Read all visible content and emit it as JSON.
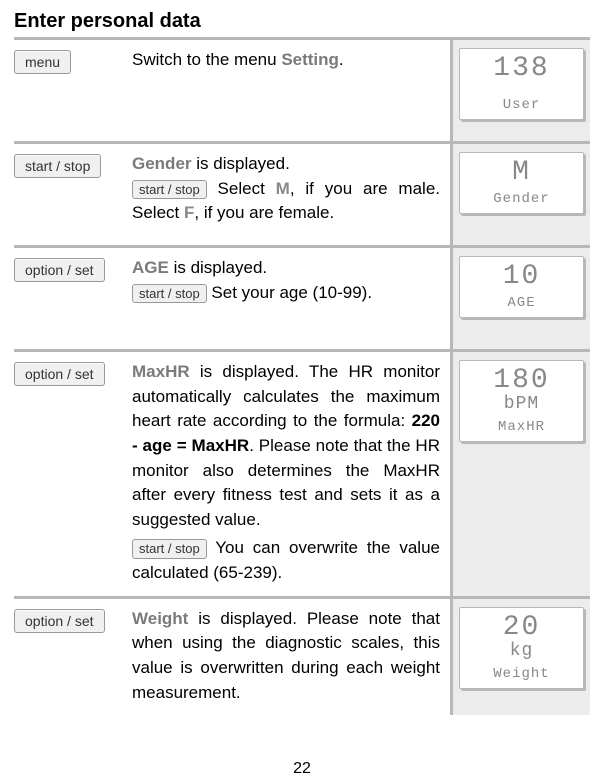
{
  "title": "Enter personal data",
  "page_number": "22",
  "buttons": {
    "menu": "menu",
    "start_stop": "start / stop",
    "option_set": "option / set"
  },
  "rows": [
    {
      "button": "menu",
      "text_before": "Switch to the menu ",
      "text_highlight": "Setting",
      "text_after": ".",
      "lcd_top": "138",
      "lcd_label": "User"
    },
    {
      "button": "start_stop",
      "lead_highlight": "Gender",
      "lead_after": " is displayed.",
      "inline_button": "start_stop",
      "body_1": " Select ",
      "m": "M",
      "body_2": ", if you are male. Select ",
      "f": "F",
      "body_3": ", if you are female.",
      "lcd_top": "M",
      "lcd_label": "Gender"
    },
    {
      "button": "option_set",
      "lead_highlight": "AGE",
      "lead_after": " is displayed.",
      "inline_button": "start_stop",
      "body_1": " Set your age (10-99).",
      "lcd_top": "10",
      "lcd_label": "AGE"
    },
    {
      "button": "option_set",
      "lead_highlight": "MaxHR",
      "lead_after": " is displayed. The HR monitor automatically calculates the maximum heart rate according to the formula: ",
      "formula": "220 - age = MaxHR",
      "body_1": ". Please note that the HR monitor also determines the MaxHR after every fitness test and sets it as a suggested value.",
      "inline_button": "start_stop",
      "body_2": " You can overwrite the value calculated (65-239).",
      "lcd_top": "180",
      "lcd_mid": "bPM",
      "lcd_label": "MaxHR"
    },
    {
      "button": "option_set",
      "lead_highlight": "Weight",
      "lead_after": " is displayed. Please note that when using the diagnostic scales, this value is overwritten during each weight measurement.",
      "lcd_top": "20",
      "lcd_mid": "kg",
      "lcd_label": "Weight"
    }
  ]
}
